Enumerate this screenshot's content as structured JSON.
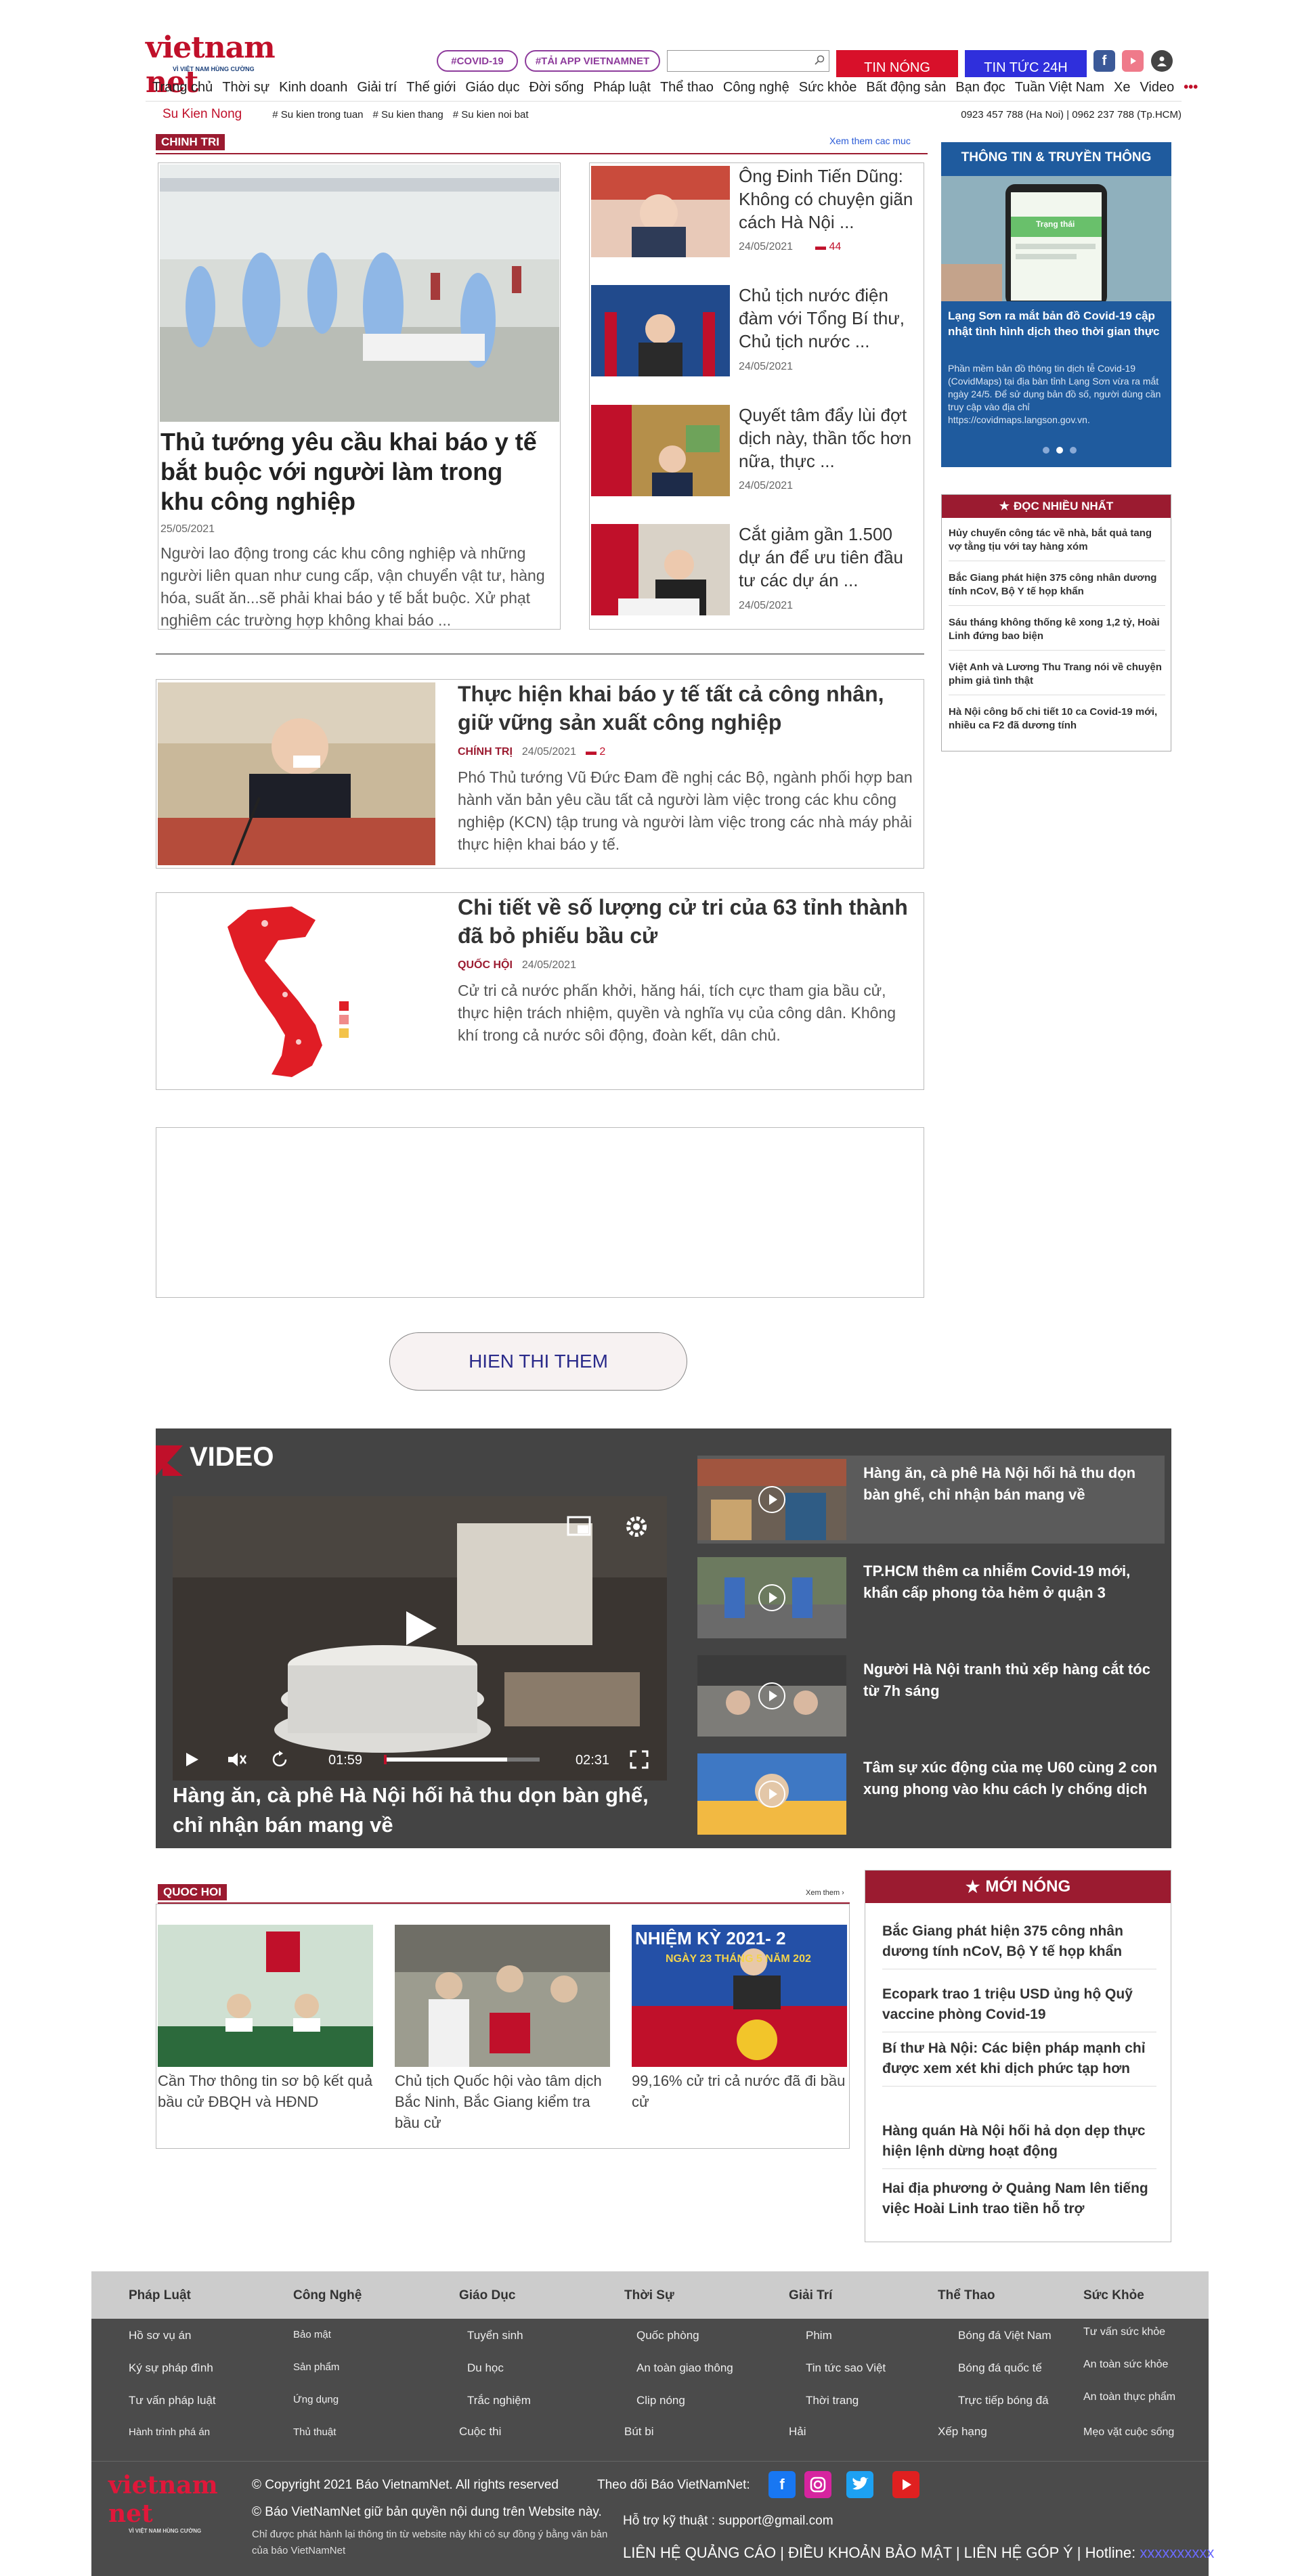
{
  "header": {
    "logo_text": "vietnam net",
    "logo_sub": "VÌ VIỆT NAM HÙNG CƯỜNG",
    "pill_covid": "#COVID-19",
    "pill_app": "#TẢI APP VIETNAMNET",
    "search_placeholder": "",
    "btn_tin_nong": "TIN NÓNG",
    "btn_tin_tuc": "TIN TỨC 24H",
    "nav": [
      "Trang chủ",
      "Thời sự",
      "Kinh doanh",
      "Giải trí",
      "Thế giới",
      "Giáo dục",
      "Đời sống",
      "Pháp luật",
      "Thể thao",
      "Công nghệ",
      "Sức khỏe",
      "Bất động sản",
      "Bạn đọc",
      "Tuần Việt Nam",
      "Xe",
      "Video"
    ],
    "nav_more": "•••",
    "subbar_label": "Su Kien Nong",
    "subbar_tags": [
      "# Su kien trong tuan",
      "# Su kien thang",
      "# Su kien noi bat"
    ],
    "hotline": "0923 457 788 (Ha Noi) | 0962 237 788 (Tp.HCM)"
  },
  "chinhtri": {
    "label": "CHINH TRI",
    "more": "Xem them cac muc",
    "lead": {
      "title": "Thủ tướng yêu cầu khai báo y tế bắt buộc với người làm trong khu công nghiệp",
      "date": "25/05/2021",
      "sapo": "Người lao động trong các khu công nghiệp và những người liên quan như cung cấp, vận chuyển vật tư, hàng hóa, suất ăn...sẽ phải khai báo y tế bắt buộc. Xử phạt nghiêm các trường hợp không khai báo ..."
    },
    "side": [
      {
        "title": "Ông Đinh Tiến Dũng: Không có chuyện giãn cách Hà Nội ...",
        "date": "24/05/2021",
        "comments": "44"
      },
      {
        "title": "Chủ tịch nước điện đàm với Tổng Bí thư, Chủ tịch nước ...",
        "date": "24/05/2021"
      },
      {
        "title": "Quyết tâm đẩy lùi đợt dịch này, thần tốc hơn nữa, thực ...",
        "date": "24/05/2021"
      },
      {
        "title": "Cắt giảm gần 1.500 dự án để ưu tiên đầu tư các dự án ...",
        "date": "24/05/2021"
      }
    ],
    "article2": {
      "title": "Thực hiện khai báo y tế tất cả công nhân, giữ vững sản xuất công nghiệp",
      "cat": "CHÍNH TRỊ",
      "date": "24/05/2021",
      "comments": "2",
      "sapo": "Phó Thủ tướng Vũ Đức Đam đề nghị các Bộ, ngành phối hợp ban hành văn bản yêu cầu tất cả người làm việc trong các khu công nghiệp (KCN) tập trung và người làm việc trong các nhà máy phải thực hiện khai báo y tế."
    },
    "article3": {
      "title": "Chi tiết về số lượng cử tri của 63 tỉnh thành đã bỏ phiếu bầu cử",
      "cat": "QUỐC HỘI",
      "date": "24/05/2021",
      "sapo": "Cử tri cả nước phấn khởi, hăng hái, tích cực tham gia bầu cử, thực hiện trách nhiệm, quyền và nghĩa vụ của công dân. Không khí trong cả nước sôi động, đoàn kết, dân chủ."
    },
    "show_more": "HIEN THI THEM"
  },
  "sidebar": {
    "panel_title": "THÔNG TIN & TRUYỀN THÔNG",
    "panel_headline": "Lạng Sơn ra mắt bản đồ Covid-19 cập nhật tình hình dịch theo thời gian thực",
    "panel_text": "Phần mềm bản đồ thông tin dịch tễ Covid-19 (CovidMaps) tại địa bàn tỉnh Lạng Sơn vừa ra mắt ngày 24/5. Để sử dụng bản đồ số, người dùng cần truy cập vào địa chỉ https://covidmaps.langson.gov.vn.",
    "phone_label": "Trạng thái",
    "doc_nhieu_title": "ĐỌC NHIỀU NHẤT",
    "doc_nhieu": [
      "Hủy chuyến công tác về nhà, bắt quả tang vợ tằng tịu với tay hàng xóm",
      "Bắc Giang phát hiện 375 công nhân dương tính nCoV, Bộ Y tế họp khẩn",
      "Sáu tháng không thống kê xong 1,2 tỷ, Hoài Linh đứng bao biện",
      "Việt Anh và Lương Thu Trang nói về chuyện phim giả tình thật",
      "Hà Nội công bố chi tiết 10 ca Covid-19 mới, nhiều ca F2 đã dương tính"
    ]
  },
  "video": {
    "label": "VIDEO",
    "time_current": "01:59",
    "time_total": "02:31",
    "progress": 0.79,
    "caption": "Hàng ăn, cà phê Hà Nội hối hả thu dọn bàn ghế, chỉ nhận bán mang về",
    "list": [
      "Hàng ăn, cà phê Hà Nội hối hả thu dọn bàn ghế, chỉ nhận bán mang về",
      "TP.HCM thêm ca nhiễm Covid-19 mới, khẩn cấp phong tỏa hẻm ở quận 3",
      "Người Hà Nội tranh thủ xếp hàng cắt tóc từ 7h sáng",
      "Tâm sự xúc động của mẹ U60 cùng 2 con xung phong vào khu cách ly chống dịch"
    ]
  },
  "quochoi": {
    "label": "QUOC HOI",
    "more": "Xem them ›",
    "items": [
      "Cần Thơ thông tin sơ bộ kết quả bầu cử ĐBQH và HĐND",
      "Chủ tịch Quốc hội vào tâm dịch Bắc Ninh, Bắc Giang kiểm tra bầu cử",
      "99,16% cử tri cả nước đã đi bầu cử"
    ],
    "banner_text": "NHIỆM KỲ 2021- 2",
    "banner_date": "NGÀY 23 THÁNG 5 NĂM 202"
  },
  "moinong": {
    "title": "MỚI NÓNG",
    "items": [
      "Bắc Giang phát hiện 375 công nhân dương tính nCoV, Bộ Y tế họp khẩn",
      "Ecopark trao 1 triệu USD ủng hộ Quỹ vaccine phòng Covid-19",
      "Bí thư Hà Nội: Các biện pháp mạnh chỉ được xem xét khi dịch phức tạp hơn",
      "Hàng quán Hà Nội hối hả dọn dẹp thực hiện lệnh dừng hoạt động",
      "Hai địa phương ở Quảng Nam lên tiếng việc Hoài Linh trao tiền hỗ trợ"
    ]
  },
  "footer": {
    "columns": [
      {
        "head": "Pháp Luật",
        "links": [
          "Hồ sơ vụ án",
          "Ký sự pháp đình",
          "Tư vấn pháp luật",
          "Hành trình phá án"
        ]
      },
      {
        "head": "Công Nghệ",
        "links": [
          "Bảo mật",
          "Sản phẩm",
          "Ứng dụng",
          "Thủ thuật"
        ]
      },
      {
        "head": "Giáo Dục",
        "links": [
          "Tuyển sinh",
          "Du học",
          "Trắc nghiệm",
          "Cuộc thi"
        ]
      },
      {
        "head": "Thời Sự",
        "links": [
          "Quốc phòng",
          "An toàn giao thông",
          "Clip nóng",
          "Bút bi"
        ]
      },
      {
        "head": "Giải Trí",
        "links": [
          "Phim",
          "Tin tức sao Việt",
          "Thời trang",
          "Hải"
        ]
      },
      {
        "head": "Thể Thao",
        "links": [
          "Bóng đá Việt Nam",
          "Bóng đá quốc tế",
          "Trực tiếp bóng đá",
          "Xếp hạng"
        ]
      },
      {
        "head": "Sức Khỏe",
        "links": [
          "Tư vấn sức khỏe",
          "An toàn sức khỏe",
          "An toàn thực phẩm",
          "Mẹo vặt cuộc sống"
        ]
      }
    ],
    "copyright": "© Copyright 2021 Báo VietnamNet. All rights reserved",
    "rights": "© Báo VietNamNet giữ bản quyền nội dung trên Website này.",
    "note": "Chỉ được phát hành lại thông tin từ website này khi có sự đồng ý bằng văn bản của báo VietNamNet",
    "follow": "Theo dõi Báo VietNamNet:",
    "support": "Hỗ trợ kỹ thuật : support@gmail.com",
    "links": "LIÊN HỆ QUẢNG CÁO | ĐIỀU KHOẢN BẢO MẬT | LIÊN HỆ GÓP Ý | Hotline:",
    "hotline": "xxxxxxxxxx",
    "logo_text": "vietnam net",
    "logo_sub": "VÌ VIỆT NAM HÙNG CƯỜNG"
  }
}
